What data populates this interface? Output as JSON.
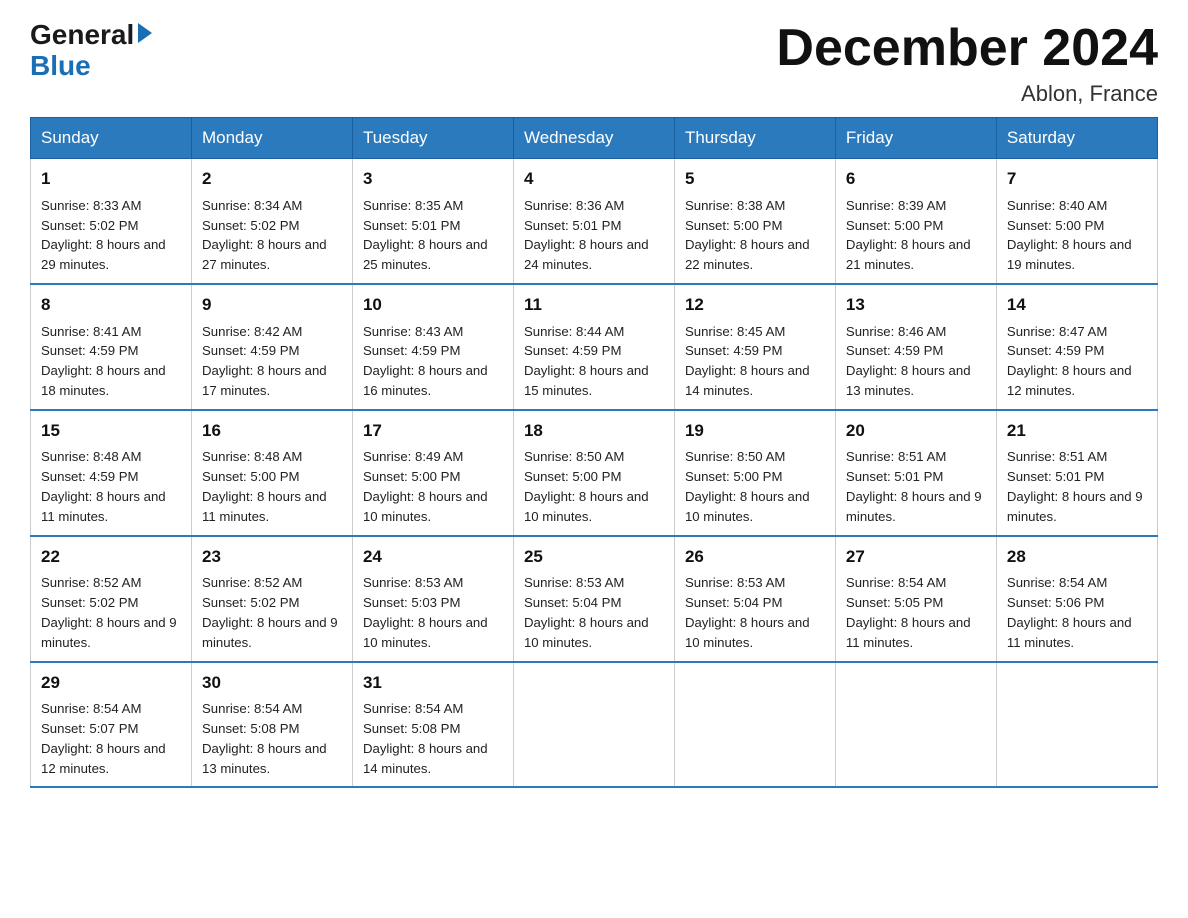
{
  "logo": {
    "general": "General",
    "blue": "Blue"
  },
  "title": "December 2024",
  "location": "Ablon, France",
  "days_of_week": [
    "Sunday",
    "Monday",
    "Tuesday",
    "Wednesday",
    "Thursday",
    "Friday",
    "Saturday"
  ],
  "weeks": [
    [
      {
        "day": "1",
        "sunrise": "8:33 AM",
        "sunset": "5:02 PM",
        "daylight": "8 hours and 29 minutes."
      },
      {
        "day": "2",
        "sunrise": "8:34 AM",
        "sunset": "5:02 PM",
        "daylight": "8 hours and 27 minutes."
      },
      {
        "day": "3",
        "sunrise": "8:35 AM",
        "sunset": "5:01 PM",
        "daylight": "8 hours and 25 minutes."
      },
      {
        "day": "4",
        "sunrise": "8:36 AM",
        "sunset": "5:01 PM",
        "daylight": "8 hours and 24 minutes."
      },
      {
        "day": "5",
        "sunrise": "8:38 AM",
        "sunset": "5:00 PM",
        "daylight": "8 hours and 22 minutes."
      },
      {
        "day": "6",
        "sunrise": "8:39 AM",
        "sunset": "5:00 PM",
        "daylight": "8 hours and 21 minutes."
      },
      {
        "day": "7",
        "sunrise": "8:40 AM",
        "sunset": "5:00 PM",
        "daylight": "8 hours and 19 minutes."
      }
    ],
    [
      {
        "day": "8",
        "sunrise": "8:41 AM",
        "sunset": "4:59 PM",
        "daylight": "8 hours and 18 minutes."
      },
      {
        "day": "9",
        "sunrise": "8:42 AM",
        "sunset": "4:59 PM",
        "daylight": "8 hours and 17 minutes."
      },
      {
        "day": "10",
        "sunrise": "8:43 AM",
        "sunset": "4:59 PM",
        "daylight": "8 hours and 16 minutes."
      },
      {
        "day": "11",
        "sunrise": "8:44 AM",
        "sunset": "4:59 PM",
        "daylight": "8 hours and 15 minutes."
      },
      {
        "day": "12",
        "sunrise": "8:45 AM",
        "sunset": "4:59 PM",
        "daylight": "8 hours and 14 minutes."
      },
      {
        "day": "13",
        "sunrise": "8:46 AM",
        "sunset": "4:59 PM",
        "daylight": "8 hours and 13 minutes."
      },
      {
        "day": "14",
        "sunrise": "8:47 AM",
        "sunset": "4:59 PM",
        "daylight": "8 hours and 12 minutes."
      }
    ],
    [
      {
        "day": "15",
        "sunrise": "8:48 AM",
        "sunset": "4:59 PM",
        "daylight": "8 hours and 11 minutes."
      },
      {
        "day": "16",
        "sunrise": "8:48 AM",
        "sunset": "5:00 PM",
        "daylight": "8 hours and 11 minutes."
      },
      {
        "day": "17",
        "sunrise": "8:49 AM",
        "sunset": "5:00 PM",
        "daylight": "8 hours and 10 minutes."
      },
      {
        "day": "18",
        "sunrise": "8:50 AM",
        "sunset": "5:00 PM",
        "daylight": "8 hours and 10 minutes."
      },
      {
        "day": "19",
        "sunrise": "8:50 AM",
        "sunset": "5:00 PM",
        "daylight": "8 hours and 10 minutes."
      },
      {
        "day": "20",
        "sunrise": "8:51 AM",
        "sunset": "5:01 PM",
        "daylight": "8 hours and 9 minutes."
      },
      {
        "day": "21",
        "sunrise": "8:51 AM",
        "sunset": "5:01 PM",
        "daylight": "8 hours and 9 minutes."
      }
    ],
    [
      {
        "day": "22",
        "sunrise": "8:52 AM",
        "sunset": "5:02 PM",
        "daylight": "8 hours and 9 minutes."
      },
      {
        "day": "23",
        "sunrise": "8:52 AM",
        "sunset": "5:02 PM",
        "daylight": "8 hours and 9 minutes."
      },
      {
        "day": "24",
        "sunrise": "8:53 AM",
        "sunset": "5:03 PM",
        "daylight": "8 hours and 10 minutes."
      },
      {
        "day": "25",
        "sunrise": "8:53 AM",
        "sunset": "5:04 PM",
        "daylight": "8 hours and 10 minutes."
      },
      {
        "day": "26",
        "sunrise": "8:53 AM",
        "sunset": "5:04 PM",
        "daylight": "8 hours and 10 minutes."
      },
      {
        "day": "27",
        "sunrise": "8:54 AM",
        "sunset": "5:05 PM",
        "daylight": "8 hours and 11 minutes."
      },
      {
        "day": "28",
        "sunrise": "8:54 AM",
        "sunset": "5:06 PM",
        "daylight": "8 hours and 11 minutes."
      }
    ],
    [
      {
        "day": "29",
        "sunrise": "8:54 AM",
        "sunset": "5:07 PM",
        "daylight": "8 hours and 12 minutes."
      },
      {
        "day": "30",
        "sunrise": "8:54 AM",
        "sunset": "5:08 PM",
        "daylight": "8 hours and 13 minutes."
      },
      {
        "day": "31",
        "sunrise": "8:54 AM",
        "sunset": "5:08 PM",
        "daylight": "8 hours and 14 minutes."
      },
      null,
      null,
      null,
      null
    ]
  ]
}
